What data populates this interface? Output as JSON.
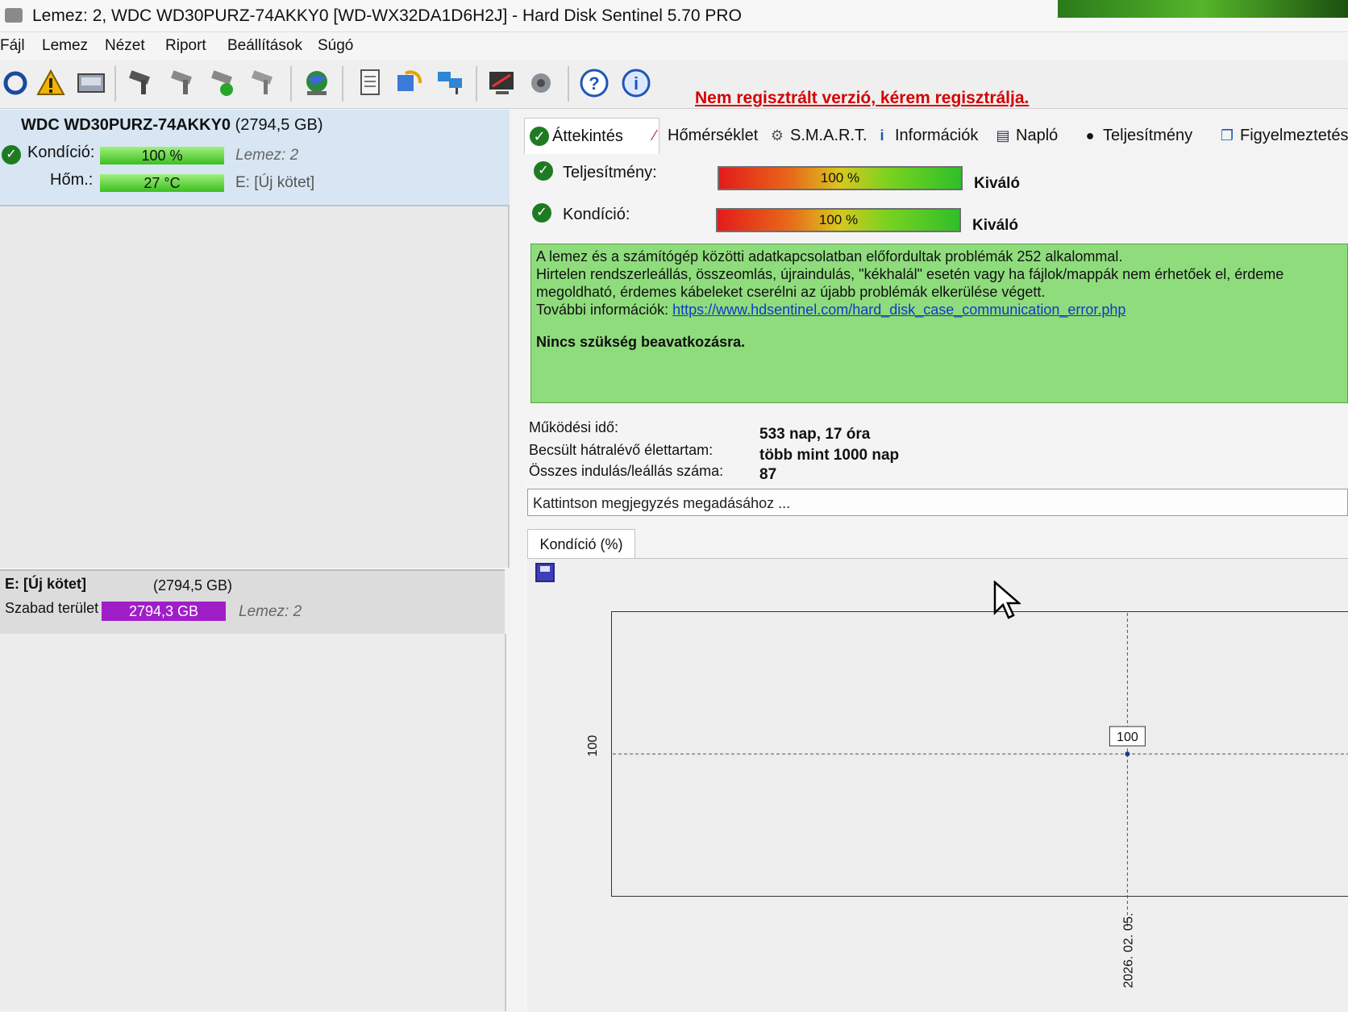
{
  "window": {
    "title": "Lemez: 2, WDC WD30PURZ-74AKKY0 [WD-WX32DA1D6H2J]  -  Hard Disk Sentinel 5.70 PRO"
  },
  "menu": [
    "Fájl",
    "Lemez",
    "Nézet",
    "Riport",
    "Beállítások",
    "Súgó"
  ],
  "toolbar": {
    "registration_warning": "Nem regisztrált verzió, kérem regisztrálja.",
    "help_glyph": "?",
    "info_glyph": "i"
  },
  "disk": {
    "model": "WDC WD30PURZ-74AKKY0",
    "size": "(2794,5 GB)",
    "health_label": "Kondíció:",
    "health_value": "100 %",
    "health_fraction": 1.0,
    "temp_label": "Hőm.:",
    "temp_value": "27 °C",
    "disk_ref": "Lemez: 2",
    "volume_ref": "E: [Új kötet]"
  },
  "volume": {
    "name": "E: [Új kötet]",
    "size": "(2794,5 GB)",
    "free_label": "Szabad terület",
    "free_value": "2794,3 GB",
    "disk_ref": "Lemez: 2"
  },
  "tabs": [
    {
      "label": "Áttekintés",
      "icon": "check-icon"
    },
    {
      "label": "Hőmérséklet",
      "icon": "thermometer-icon"
    },
    {
      "label": "S.M.A.R.T.",
      "icon": "smart-icon"
    },
    {
      "label": "Információk",
      "icon": "info-icon"
    },
    {
      "label": "Napló",
      "icon": "log-icon"
    },
    {
      "label": "Teljesítmény",
      "icon": "performance-icon"
    },
    {
      "label": "Figyelmeztetés",
      "icon": "alert-icon"
    }
  ],
  "overview": {
    "performance": {
      "label": "Teljesítmény:",
      "value": "100 %",
      "fraction": 1.0,
      "rating": "Kiváló"
    },
    "health": {
      "label": "Kondíció:",
      "value": "100 %",
      "fraction": 1.0,
      "rating": "Kiváló"
    },
    "message_lines": [
      "A lemez és a számítógép közötti adatkapcsolatban előfordultak problémák 252 alkalommal.",
      "Hirtelen rendszerleállás, összeomlás, újraindulás, \"kékhalál\" esetén vagy ha fájlok/mappák nem érhetőek el, érdeme",
      "megoldható, érdemes kábeleket cserélni az újabb problémák elkerülése végett."
    ],
    "more_info_label": "További információk:",
    "more_info_link": "https://www.hdsentinel.com/hard_disk_case_communication_error.php",
    "action_text": "Nincs szükség beavatkozásra.",
    "stats": [
      {
        "label": "Működési idő:",
        "value": "533 nap, 17 óra"
      },
      {
        "label": "Becsült hátralévő élettartam:",
        "value": "több mint 1000 nap"
      },
      {
        "label": "Összes indulás/leállás száma:",
        "value": "87"
      }
    ],
    "note_placeholder": "Kattintson megjegyzés megadásához ...",
    "graph_tab": "Kondíció  (%)"
  },
  "chart_data": {
    "type": "line",
    "x": [
      "2026. 02. 05."
    ],
    "series": [
      {
        "values": [
          100
        ]
      }
    ],
    "point_labels": [
      "100"
    ],
    "y_tick_labels": [
      "100"
    ],
    "x_tick_labels": [
      "2026. 02. 05."
    ],
    "grid": true
  }
}
